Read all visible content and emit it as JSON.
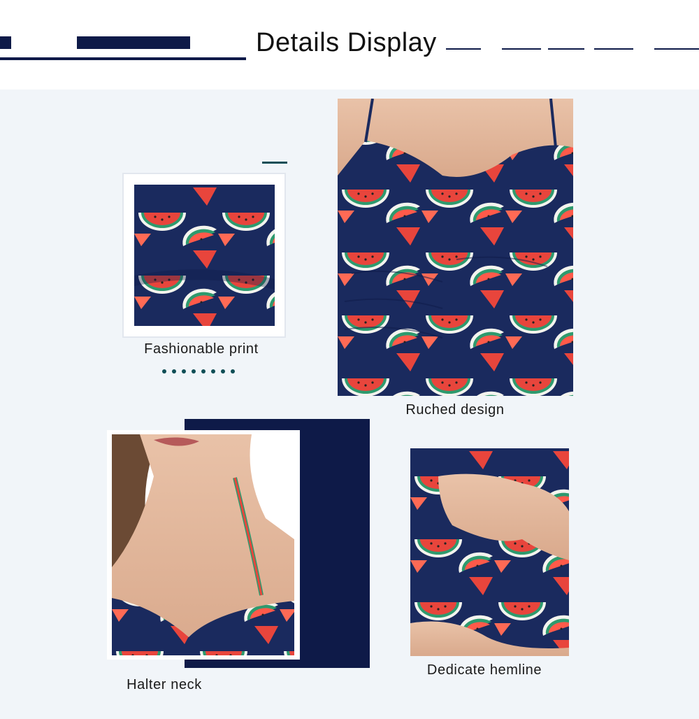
{
  "header": {
    "title": "Details Display"
  },
  "captions": {
    "print": "Fashionable print",
    "ruched": "Ruched design",
    "halter": "Halter neck",
    "hemline": "Dedicate hemline"
  },
  "colors": {
    "navy": "#0e1a48",
    "panel": "#f1f5f9",
    "teal": "#0f4e56",
    "watermelon_red": "#e8453c",
    "rind_green": "#2e9a6e"
  },
  "decor": {
    "dot_count": 8
  }
}
